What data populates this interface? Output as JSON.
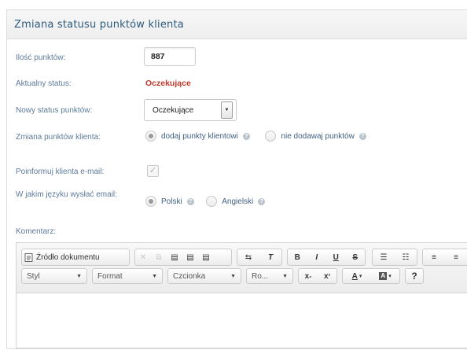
{
  "panel": {
    "title": "Zmiana statusu punktów klienta"
  },
  "fields": {
    "points_label": "Ilość punktów:",
    "points_value": "887",
    "current_status_label": "Aktualny status:",
    "current_status_value": "Oczekujące",
    "new_status_label": "Nowy status punktów:",
    "new_status_value": "Oczekujące",
    "change_label": "Zmiana punktów klienta:",
    "change_option_add": "dodaj punkty klientowi",
    "change_option_skip": "nie dodawaj punktów",
    "notify_label": "Poinformuj klienta e-mail:",
    "notify_checked": true,
    "language_label": "W jakim języku wysłać email:",
    "language_option_pl": "Polski",
    "language_option_en": "Angielski",
    "comment_label": "Komentarz:"
  },
  "editor": {
    "source_label": "Źródło dokumentu",
    "combo_style": "Styl",
    "combo_format": "Format",
    "combo_font": "Czcionka",
    "combo_size": "Ro...",
    "help_label": "?"
  },
  "colors": {
    "accent": "#2c5a7c",
    "status": "#c0392b",
    "label": "#5c7a99"
  }
}
